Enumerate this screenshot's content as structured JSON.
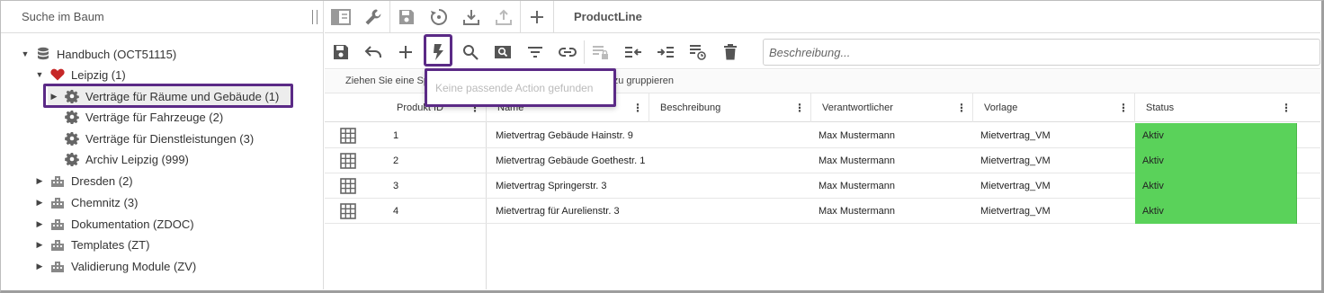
{
  "sidebar": {
    "search_placeholder": "Suche im Baum",
    "tree": [
      {
        "label": "Handbuch (OCT51115)",
        "icon": "database-icon",
        "expanded": true
      },
      {
        "label": "Leipzig (1)",
        "icon": "heart-icon",
        "expanded": true
      },
      {
        "label": "Verträge für Räume und Gebäude (1)",
        "icon": "gear-icon",
        "selected": true
      },
      {
        "label": "Verträge für Fahrzeuge (2)",
        "icon": "gear-icon"
      },
      {
        "label": "Verträge für Dienstleistungen (3)",
        "icon": "gear-icon"
      },
      {
        "label": "Archiv Leipzig (999)",
        "icon": "gear-icon"
      },
      {
        "label": "Dresden (2)",
        "icon": "building-icon"
      },
      {
        "label": "Chemnitz (3)",
        "icon": "building-icon"
      },
      {
        "label": "Dokumentation (ZDOC)",
        "icon": "building-icon"
      },
      {
        "label": "Templates (ZT)",
        "icon": "building-icon"
      },
      {
        "label": "Validierung Module (ZV)",
        "icon": "building-icon"
      }
    ]
  },
  "topbar": {
    "title": "ProductLine"
  },
  "toolbar2": {
    "description_placeholder": "Beschreibung..."
  },
  "groupbar": {
    "text": "Ziehen Sie eine Sp                                                               te zu gruppieren"
  },
  "popup": {
    "text": "Keine passende Action gefunden"
  },
  "grid": {
    "columns": [
      "Produkt ID",
      "Name",
      "Beschreibung",
      "Verantwortlicher",
      "Vorlage",
      "Status"
    ],
    "rows": [
      {
        "id": "1",
        "name": "Mietvertrag Gebäude Hainstr. 9",
        "desc": "",
        "owner": "Max Mustermann",
        "template": "Mietvertrag_VM",
        "status": "Aktiv"
      },
      {
        "id": "2",
        "name": "Mietvertrag Gebäude Goethestr. 1",
        "desc": "",
        "owner": "Max Mustermann",
        "template": "Mietvertrag_VM",
        "status": "Aktiv"
      },
      {
        "id": "3",
        "name": "Mietvertrag Springerstr. 3",
        "desc": "",
        "owner": "Max Mustermann",
        "template": "Mietvertrag_VM",
        "status": "Aktiv"
      },
      {
        "id": "4",
        "name": "Mietvertrag für Aurelienstr. 3",
        "desc": "",
        "owner": "Max Mustermann",
        "template": "Mietvertrag_VM",
        "status": "Aktiv"
      }
    ]
  },
  "colors": {
    "highlight": "#5b2a86",
    "status_active": "#5ad25a",
    "heart": "#c62828"
  }
}
